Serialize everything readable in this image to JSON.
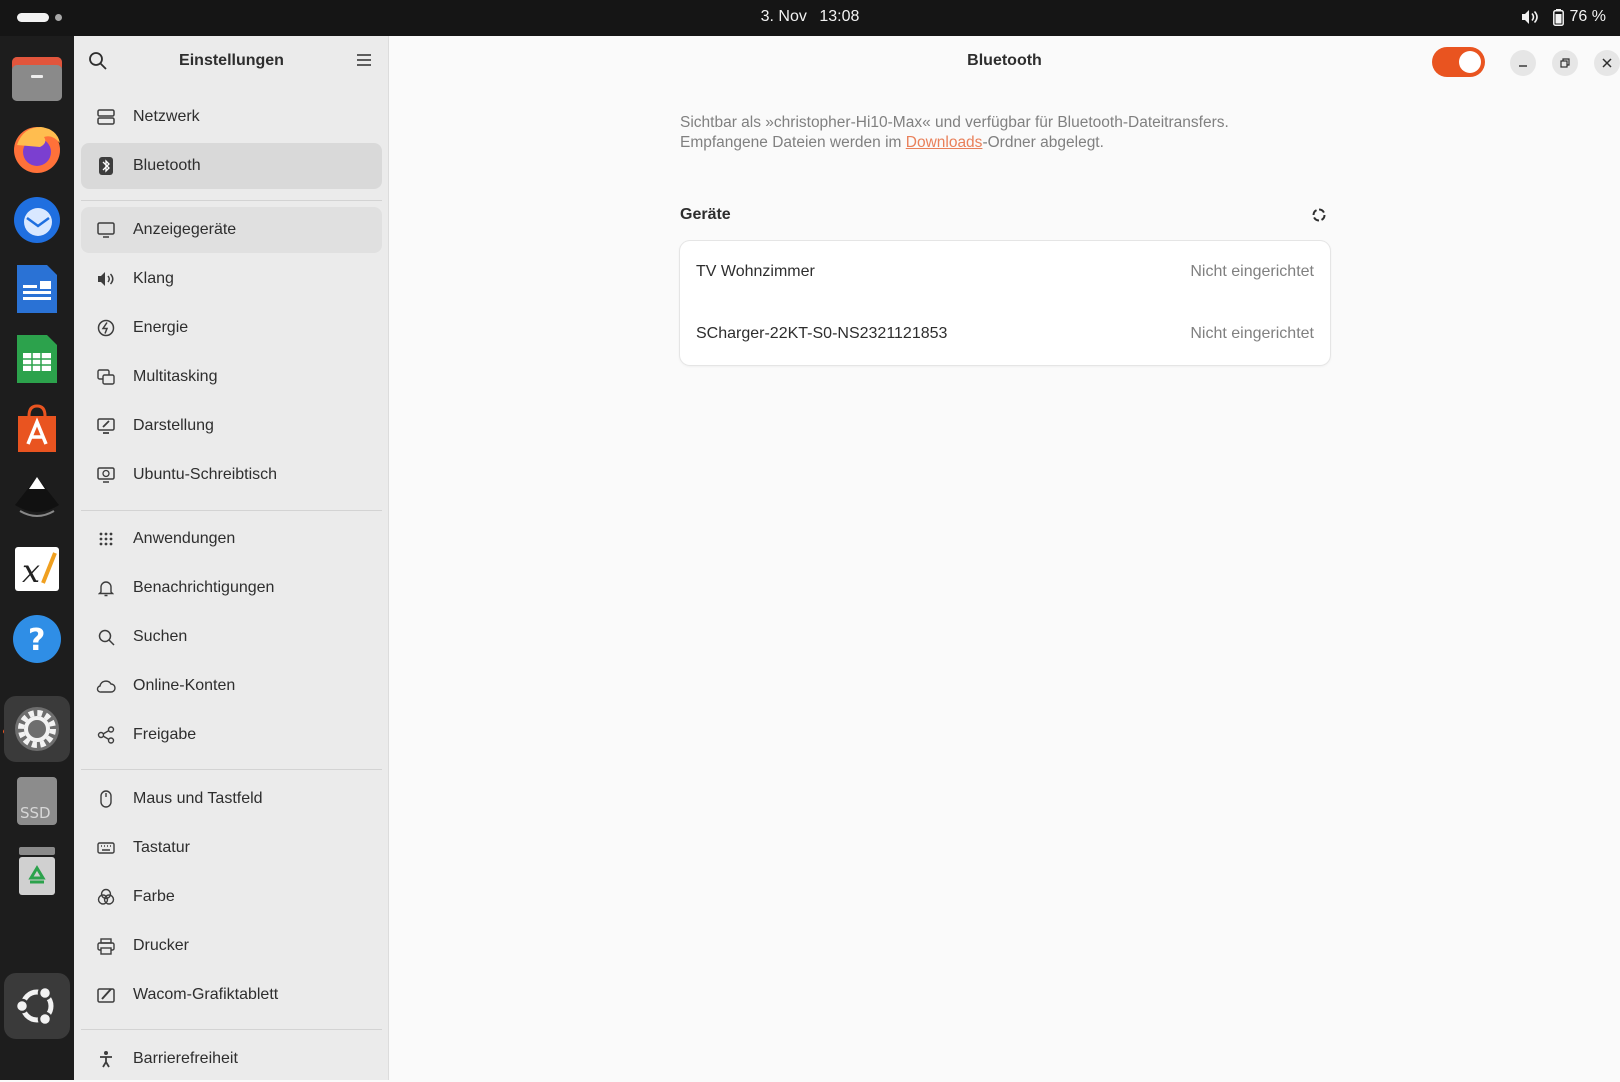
{
  "topbar": {
    "date": "3. Nov",
    "time": "13:08",
    "battery": "76 %"
  },
  "dock": {
    "apps": [
      {
        "name": "files",
        "icon": "files-icon"
      },
      {
        "name": "firefox",
        "icon": "firefox-icon"
      },
      {
        "name": "thunderbird",
        "icon": "thunderbird-icon"
      },
      {
        "name": "writer",
        "icon": "libreoffice-writer-icon"
      },
      {
        "name": "calc",
        "icon": "libreoffice-calc-icon"
      },
      {
        "name": "app-center",
        "icon": "app-center-icon"
      },
      {
        "name": "inkscape",
        "icon": "inkscape-icon"
      },
      {
        "name": "xournal",
        "icon": "xournal-icon"
      },
      {
        "name": "help",
        "icon": "help-icon"
      },
      {
        "name": "settings",
        "icon": "settings-icon"
      },
      {
        "name": "ssd",
        "icon": "ssd-drive-icon",
        "label": "SSD"
      },
      {
        "name": "trash",
        "icon": "trash-icon"
      },
      {
        "name": "show-apps",
        "icon": "ubuntu-icon"
      }
    ]
  },
  "sidebar": {
    "title": "Einstellungen",
    "items": [
      {
        "label": "Netzwerk",
        "icon": "network-icon"
      },
      {
        "label": "Bluetooth",
        "icon": "bluetooth-icon"
      },
      {
        "label": "Anzeigegeräte",
        "icon": "display-icon"
      },
      {
        "label": "Klang",
        "icon": "sound-icon"
      },
      {
        "label": "Energie",
        "icon": "power-icon"
      },
      {
        "label": "Multitasking",
        "icon": "multitasking-icon"
      },
      {
        "label": "Darstellung",
        "icon": "appearance-icon"
      },
      {
        "label": "Ubuntu-Schreibtisch",
        "icon": "ubuntu-desktop-icon"
      },
      {
        "label": "Anwendungen",
        "icon": "apps-grid-icon"
      },
      {
        "label": "Benachrichtigungen",
        "icon": "bell-icon"
      },
      {
        "label": "Suchen",
        "icon": "search-icon"
      },
      {
        "label": "Online-Konten",
        "icon": "cloud-icon"
      },
      {
        "label": "Freigabe",
        "icon": "share-icon"
      },
      {
        "label": "Maus und Tastfeld",
        "icon": "mouse-icon"
      },
      {
        "label": "Tastatur",
        "icon": "keyboard-icon"
      },
      {
        "label": "Farbe",
        "icon": "color-icon"
      },
      {
        "label": "Drucker",
        "icon": "printer-icon"
      },
      {
        "label": "Wacom-Grafiktablett",
        "icon": "tablet-icon"
      },
      {
        "label": "Barrierefreiheit",
        "icon": "accessibility-icon"
      }
    ]
  },
  "main": {
    "title": "Bluetooth",
    "description_line1": "Sichtbar als »christopher-Hi10-Max« und verfügbar für Bluetooth-Dateitransfers.",
    "description_line2_pre": "Empfangene Dateien werden im ",
    "description_link": "Downloads",
    "description_line2_post": "-Ordner abgelegt.",
    "devices_heading": "Geräte",
    "devices": [
      {
        "name": "TV Wohnzimmer",
        "status": "Nicht eingerichtet"
      },
      {
        "name": "SCharger-22KT-S0-NS2321121853",
        "status": "Nicht eingerichtet"
      }
    ]
  },
  "colors": {
    "accent": "#e95420"
  }
}
